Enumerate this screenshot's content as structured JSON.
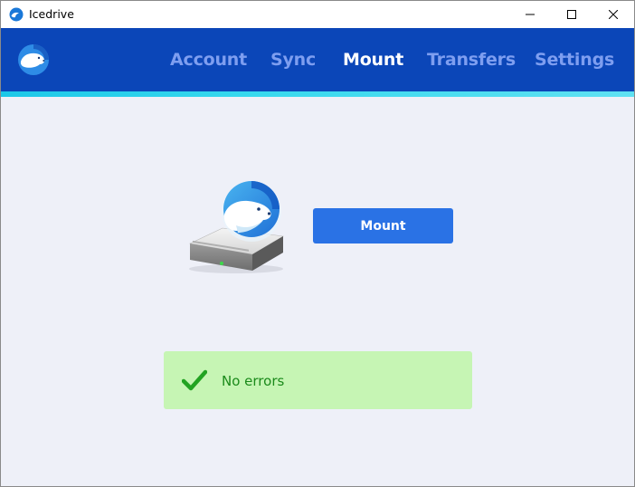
{
  "window": {
    "title": "Icedrive"
  },
  "nav": {
    "items": [
      {
        "label": "Account",
        "active": false
      },
      {
        "label": "Sync",
        "active": false
      },
      {
        "label": "Mount",
        "active": true
      },
      {
        "label": "Transfers",
        "active": false
      },
      {
        "label": "Settings",
        "active": false
      }
    ]
  },
  "mount": {
    "button_label": "Mount"
  },
  "status": {
    "text": "No errors",
    "icon": "check-icon"
  },
  "colors": {
    "header": "#0b46b8",
    "nav_inactive": "#7e9ef0",
    "nav_active": "#ffffff",
    "button": "#2a72e5",
    "status_bg": "#c6f5b4",
    "status_text": "#1b8a1b",
    "content_bg": "#eef0f8"
  }
}
